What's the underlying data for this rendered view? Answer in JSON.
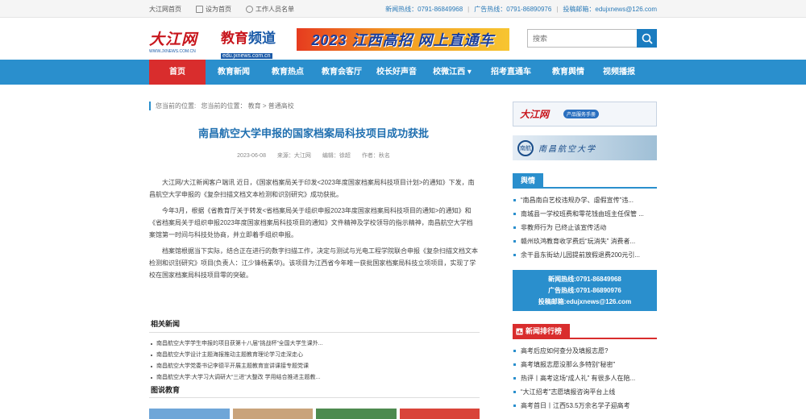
{
  "topbar": {
    "links": [
      "大江网首页",
      "设为首页",
      "工作人员名单"
    ],
    "news_hotline": "新闻热线：0791-86849968",
    "ad_hotline": "广告热线：0791-86890976",
    "email": "投稿邮箱：edujxnews@126.com",
    "sep": "|"
  },
  "header": {
    "logo_main": "大江网",
    "logo_main_sub": "WWW.JXNEWS.COM.CN",
    "logo_edu_a": "教育",
    "logo_edu_b": "频道",
    "logo_edu_url": "edu.jxnews.com.cn",
    "banner": "2023 江西高招 网上直通车",
    "search_placeholder": "搜索"
  },
  "nav": [
    "首页",
    "教育新闻",
    "教育热点",
    "教育会客厅",
    "校长好声音",
    "校微江西 ▾",
    "招考直通车",
    "教育舆情",
    "视频播报"
  ],
  "breadcrumb": {
    "label": "您当前的位置:",
    "path": "您当前的位置： 教育 > 普通高校"
  },
  "article": {
    "title": "南昌航空大学申报的国家档案局科技项目成功获批",
    "date": "2023-06-08",
    "source": "来源：大江网",
    "editor": "编辑：徐超",
    "author": "作者：秋名",
    "paragraphs": [
      "大江网/大江新闻客户端讯 近日，《国家档案局关于印发<2023年度国家档案局科技项目计划>的通知》下发，南昌航空大学申报的《复杂扫描文档文本检测和识别研究》成功获批。",
      "今年3月，根据《省教育厅关于转发<省档案局关于组织申报2023年度国家档案局科技项目的通知>的通知》和《省档案局关于组织申报2023年度国家档案局科技项目的通知》文件精神及学校领导的指示精神，南昌航空大学档案馆第一时间与科技处协商，并立即着手组织申报。",
      "档案馆根据当下实际，结合正在进行的数字扫描工作，决定与测试与光电工程学院联合申报《复杂扫描文档文本检测和识别研究》项目(负责人：江少锋杨素华)。该项目为江西省今年唯一获批国家档案局科技立项项目，实现了学校在国家档案局科技项目零的突破。"
    ]
  },
  "related": {
    "heading": "相关新闻",
    "items": [
      "南昌航空大学学生申报的项目获第十八届“挑战杯”全国大学生课外...",
      "南昌航空大学设计主题海报推动主题教育理论学习走深走心",
      "南昌航空大学党委书记李德平开展主题教育宣讲课接专题党课",
      "南昌航空大学:大学习大调研大“三进”大整改 学用结合推进主题教..."
    ]
  },
  "pictures": {
    "heading": "图说教育",
    "colors": [
      "#6fa6d8",
      "#c9a37b",
      "#4d8a4f",
      "#d9443a"
    ]
  },
  "sidebar": {
    "ad1_logo": "大江网",
    "ad1_tag": "产品服务手册",
    "ad2_seal": "南航",
    "ad2_name": "南昌航空大学",
    "opinion_heading": "舆情",
    "opinion_items": [
      "“南昌南白艺校违规办学、虐假宣传”违...",
      "南城县一学校班费和零花钱由班主任保管 ...",
      "非教师行为 已终止该宣传活动",
      "赣州玖鸿教育收学费后“玩消失” 消费者...",
      "余干县东街幼儿园提前放假退费200元引..."
    ],
    "hotline_news": "新闻热线:0791-86849968",
    "hotline_ad": "广告热线:0791-86890976",
    "hotline_email": "投稿邮箱:edujxnews@126.com",
    "rank_heading": "新闻排行榜",
    "rank_items": [
      "高考后应如何查分及填报志愿?",
      "高考填报志愿没那么多特别“秘密”",
      "热评丨高考这场“成人礼” 有很多人在陪...",
      "“大江招考”志愿填报咨询平台上线",
      "高考首日丨江西53.5万余名学子迎高考"
    ]
  }
}
